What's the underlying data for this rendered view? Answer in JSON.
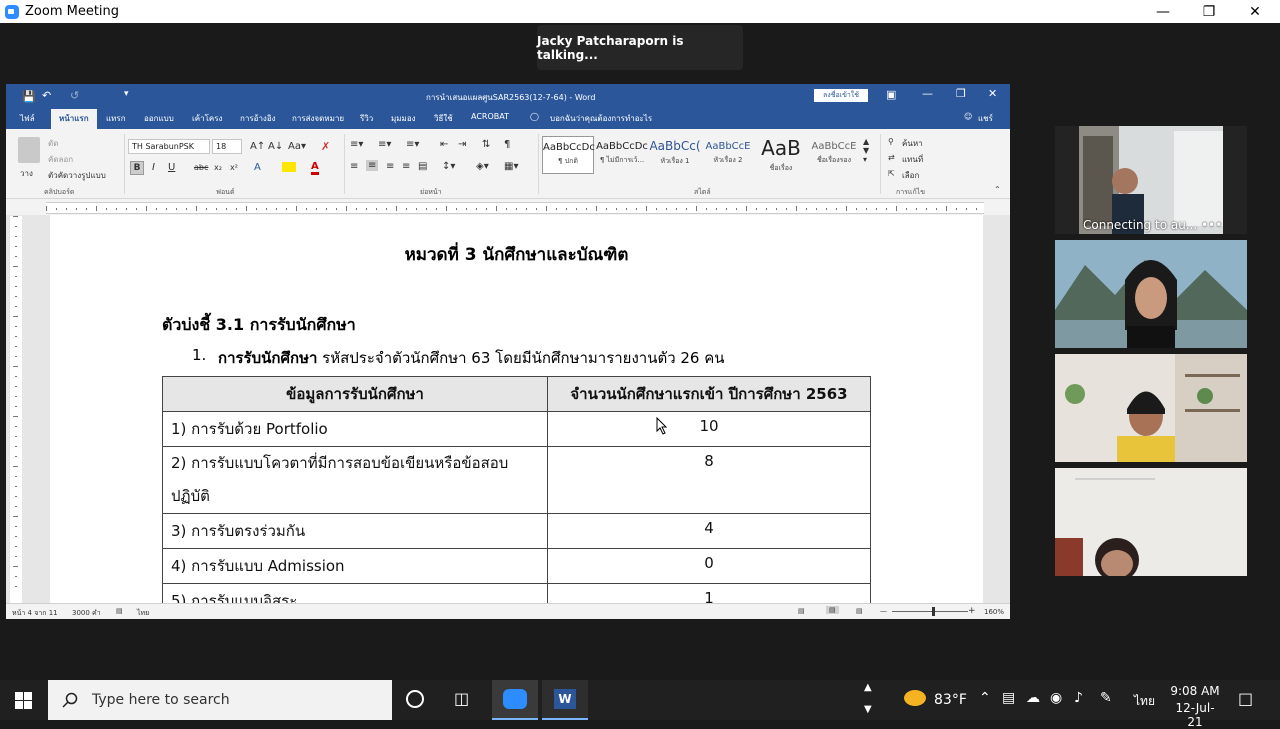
{
  "zoom": {
    "title": "Zoom Meeting",
    "talking": "Jacky Patcharaporn is talking...",
    "participants": [
      {
        "caption": "Connecting to au... •••"
      },
      {
        "caption": ""
      },
      {
        "caption": ""
      },
      {
        "caption": ""
      }
    ]
  },
  "word": {
    "title": "การนำเสนอแผลศูนSAR2563(12-7-64) - Word",
    "signin": "ลงชื่อเข้าใช้",
    "tabs": [
      "ไฟล์",
      "หน้าแรก",
      "แทรก",
      "ออกแบบ",
      "เค้าโครง",
      "การอ้างอิง",
      "การส่งจดหมาย",
      "รีวิว",
      "มุมมอง",
      "วิธีใช้",
      "ACROBAT"
    ],
    "tell_me": "บอกฉันว่าคุณต้องการทำอะไร",
    "share": "แชร์",
    "ribbon": {
      "paste": "วาง",
      "cut": "ตัด",
      "copy": "คัดลอก",
      "format_painter": "ตัวคัดวางรูปแบบ",
      "clipboard_label": "คลิปบอร์ด",
      "font_name": "TH SarabunPSK",
      "font_size": "18",
      "font_label": "ฟอนต์",
      "paragraph_label": "ย่อหน้า",
      "styles_label": "สไตล์",
      "editing_label": "การแก้ไข",
      "find": "ค้นหา",
      "replace": "แทนที่",
      "select": "เลือก",
      "styles": [
        {
          "preview": "AaBbCcDc",
          "name": "¶ ปกติ"
        },
        {
          "preview": "AaBbCcDc",
          "name": "¶ ไม่มีการเว้..."
        },
        {
          "preview": "AaBbCc(",
          "name": "หัวเรื่อง 1"
        },
        {
          "preview": "AaBbCcE",
          "name": "หัวเรื่อง 2"
        },
        {
          "preview": "AaB",
          "name": "ชื่อเรื่อง"
        },
        {
          "preview": "AaBbCcE",
          "name": "ชื่อเรื่องรอง"
        }
      ]
    },
    "document": {
      "heading": "หมวดที่ 3 นักศึกษาและบัณฑิต",
      "indicator": "ตัวบ่งชี้ 3.1 การรับนักศึกษา",
      "item_number": "1.",
      "item_bold": "การรับนักศึกษา",
      "item_text": "รหัสประจำตัวนักศึกษา 63 โดยมีนักศึกษามารายงานตัว 26 คน",
      "table": {
        "headers": [
          "ข้อมูลการรับนักศึกษา",
          "จำนวนนักศึกษาแรกเข้า ปีการศึกษา 2563"
        ],
        "rows": [
          {
            "label": "1) การรับด้วย Portfolio",
            "value": "10"
          },
          {
            "label": "2) การรับแบบโควตาที่มีการสอบข้อเขียนหรือข้อสอบปฏิบัติ",
            "value": "8"
          },
          {
            "label": "3) การรับตรงร่วมกัน",
            "value": "4"
          },
          {
            "label": "4) การรับแบบ Admission",
            "value": "0"
          },
          {
            "label": "5) การรับแบบอิสระ",
            "value": "1"
          }
        ]
      }
    },
    "status": {
      "page": "หน้า 4 จาก 11",
      "words": "3000 คำ",
      "lang": "ไทย",
      "zoom": "160%"
    }
  },
  "taskbar": {
    "search_placeholder": "Type here to search",
    "weather": "83°F",
    "lang": "ไทย",
    "time": "9:08 AM",
    "date": "12-Jul-21"
  },
  "colors": {
    "word_blue": "#2b579a",
    "zoom_blue": "#2d8cff",
    "taskbar": "#202020"
  }
}
